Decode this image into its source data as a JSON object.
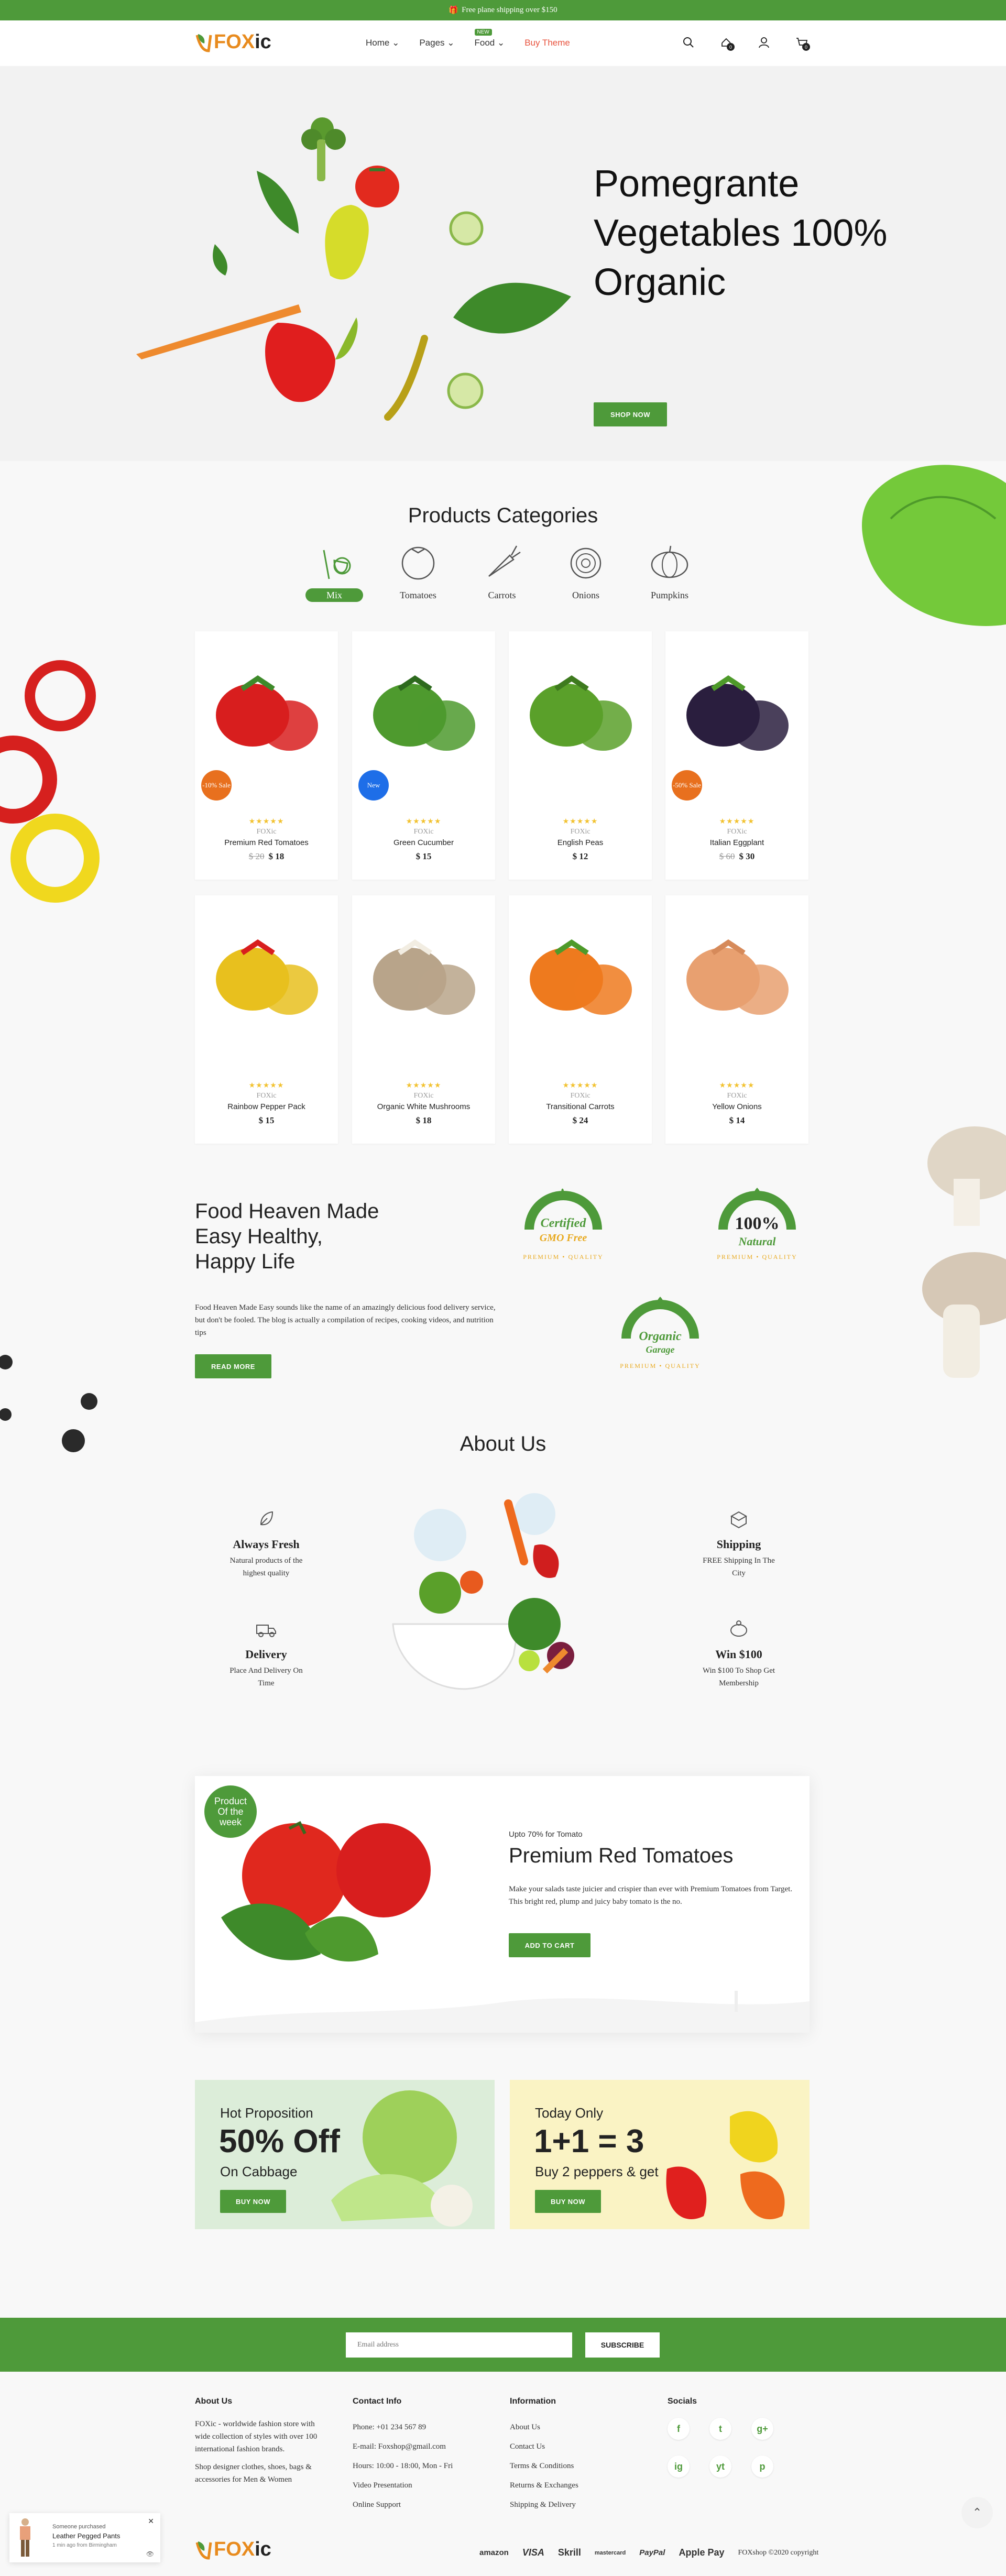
{
  "topbar": {
    "text": "Free plane shipping over $150"
  },
  "header": {
    "logo_fox": "FOX",
    "logo_ic": "ic",
    "nav": [
      {
        "label": "Home"
      },
      {
        "label": "Pages"
      },
      {
        "label": "Food"
      },
      {
        "label": "Buy Theme"
      }
    ],
    "nav_badge": "NEW",
    "compare_count": "0",
    "cart_count": "0"
  },
  "hero": {
    "title": "Pomegrante Vegetables 100% Organic",
    "button": "SHOP NOW"
  },
  "categories": {
    "title": "Products Categories",
    "items": [
      {
        "label": "Mix"
      },
      {
        "label": "Tomatoes"
      },
      {
        "label": "Carrots"
      },
      {
        "label": "Onions"
      },
      {
        "label": "Pumpkins"
      }
    ]
  },
  "products": [
    {
      "name": "Premium Red Tomatoes",
      "brand": "FOXic",
      "old": "$ 20",
      "price": "$ 18",
      "badge": "-10% Sale"
    },
    {
      "name": "Green Cucumber",
      "brand": "FOXic",
      "old": "",
      "price": "$ 15",
      "badge": "New"
    },
    {
      "name": "English Peas",
      "brand": "FOXic",
      "old": "",
      "price": "$ 12",
      "badge": ""
    },
    {
      "name": "Italian Eggplant",
      "brand": "FOXic",
      "old": "$ 60",
      "price": "$ 30",
      "badge": "-50% Sale"
    },
    {
      "name": "Rainbow Pepper Pack",
      "brand": "FOXic",
      "old": "",
      "price": "$ 15",
      "badge": ""
    },
    {
      "name": "Organic White Mushrooms",
      "brand": "FOXic",
      "old": "",
      "price": "$ 18",
      "badge": ""
    },
    {
      "name": "Transitional Carrots",
      "brand": "FOXic",
      "old": "",
      "price": "$ 24",
      "badge": ""
    },
    {
      "name": "Yellow Onions",
      "brand": "FOXic",
      "old": "",
      "price": "$ 14",
      "badge": ""
    }
  ],
  "stars": "★★★★★",
  "healthy": {
    "title_lines": [
      "Food Heaven Made",
      "Easy Healthy,",
      "Happy Life"
    ],
    "text": "Food Heaven Made Easy sounds like the name of an amazingly delicious food delivery service, but don't be fooled. The blog is actually a compilation of recipes, cooking videos, and nutrition tips",
    "button": "READ MORE",
    "badges": [
      {
        "main": "Certified",
        "sub": "GMO Free",
        "ring": "PREMIUM • QUALITY"
      },
      {
        "main": "100%",
        "sub": "Natural",
        "ring": "PREMIUM • QUALITY"
      },
      {
        "main": "Organic",
        "sub": "Garage",
        "ring": "PREMIUM • QUALITY"
      }
    ]
  },
  "about": {
    "title": "About Us",
    "features": [
      {
        "title": "Always Fresh",
        "text": "Natural products of the highest quality"
      },
      {
        "title": "Shipping",
        "text": "FREE Shipping In The City"
      },
      {
        "title": "Delivery",
        "text": "Place And Delivery On Time"
      },
      {
        "title": "Win $100",
        "text": "Win $100 To Shop Get Membership"
      }
    ]
  },
  "product_of_week": {
    "badge": "Product Of the week",
    "kicker": "Upto 70% for Tomato",
    "title": "Premium Red Tomatoes",
    "text": "Make your salads taste juicier and crispier than ever with Premium Tomatoes from Target. This bright red, plump and juicy baby tomato is the no.",
    "button": "ADD TO CART"
  },
  "promos": [
    {
      "kicker": "Hot Proposition",
      "big": "50% Off",
      "sub": "On Cabbage",
      "button": "BUY NOW",
      "bg": "#dcedd9"
    },
    {
      "kicker": "Today Only",
      "big": "1+1 = 3",
      "sub": "Buy 2 peppers & get",
      "button": "BUY NOW",
      "bg": "#faf3c4"
    }
  ],
  "newsletter": {
    "placeholder": "Email address",
    "button": "SUBSCRIBE"
  },
  "footer": {
    "about": {
      "title": "About Us",
      "lines": [
        "FOXic - worldwide fashion store with",
        "wide collection of styles with over 100",
        "international fashion brands.",
        "Shop designer clothes, shoes, bags &",
        "accessories for Men & Women"
      ]
    },
    "contact": {
      "title": "Contact Info",
      "lines": [
        "Phone: +01 234 567 89",
        "E-mail: Foxshop@gmail.com",
        "Hours: 10:00 - 18:00, Mon - Fri",
        "Video Presentation",
        "Online Support"
      ]
    },
    "info": {
      "title": "Information",
      "lines": [
        "About Us",
        "Contact Us",
        "Terms & Conditions",
        "Returns & Exchanges",
        "Shipping & Delivery"
      ]
    },
    "socials": {
      "title": "Socials",
      "icons": [
        "f",
        "t",
        "g+",
        "ig",
        "yt",
        "p"
      ]
    },
    "payments": [
      "amazon",
      "VISA",
      "Skrill",
      "mastercard",
      "PayPal",
      "Apple Pay"
    ],
    "copyright": "FOXshop ©2020 copyright"
  },
  "toast": {
    "line1": "Someone purchased",
    "line2": "Leather Pegged Pants",
    "line3": "1 min ago from Birmingham"
  },
  "colors": {
    "brand": "#4e9a3a",
    "accent": "#e8533e",
    "sale": "#e8701e",
    "new": "#1e6ee8"
  }
}
